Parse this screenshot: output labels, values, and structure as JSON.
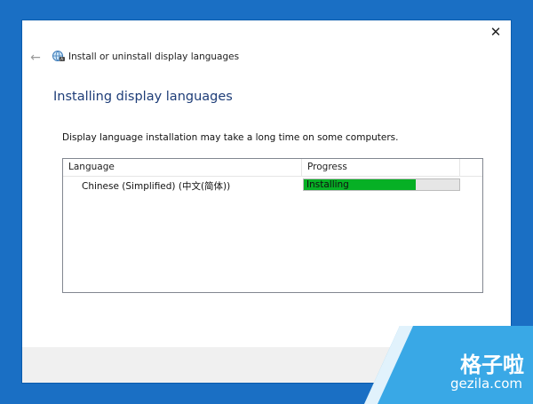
{
  "window": {
    "close_glyph": "✕",
    "back_glyph": "←",
    "nav_title": "Install or uninstall display languages",
    "nav_icon": "globe-language-icon"
  },
  "main": {
    "title": "Installing display languages",
    "info": "Display language installation may take a long time on some computers."
  },
  "table": {
    "columns": [
      "Language",
      "Progress"
    ],
    "rows": [
      {
        "language": "Chinese (Simplified) (中文(简体))",
        "status": "Installing",
        "progress_fraction": 0.72
      }
    ]
  },
  "watermark": {
    "cn": "格子啦",
    "en": "gezila.com"
  },
  "colors": {
    "desktop": "#1a6fc4",
    "title_blue": "#1e3d78",
    "progress_green": "#06b025",
    "watermark_blue": "#39a8e6"
  }
}
